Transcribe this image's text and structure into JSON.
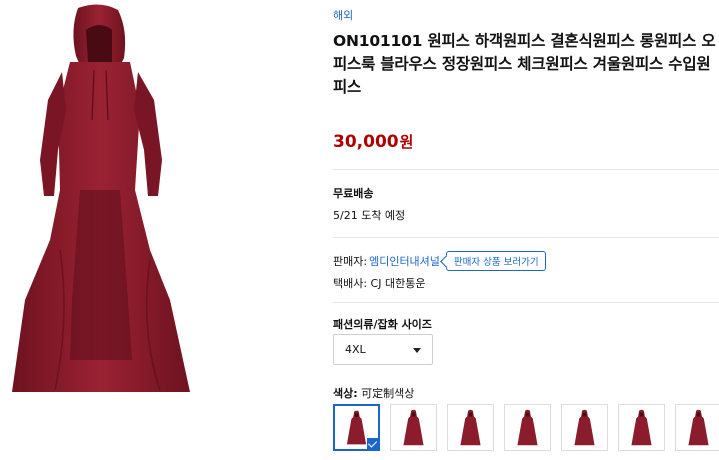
{
  "product": {
    "origin_tag": "해외",
    "title": "ON101101 원피스 하객원피스 결혼식원피스 롱원피스 오피스룩 블라우스 정장원피스 체크원피스 겨울원피스 수입원피스",
    "price": "30,000",
    "currency": "원",
    "image_icon": "hooded-dress-image"
  },
  "shipping": {
    "title": "무료배송",
    "eta": "5/21 도착 예정"
  },
  "seller": {
    "label": "판매자:",
    "name": "엠디인터내셔널",
    "button": "판매자 상품 보러가기",
    "courier": "택배사: CJ 대한통운"
  },
  "option": {
    "size_label": "패션의류/잡화 사이즈",
    "size_value": "4XL",
    "color_label_bold": "색상:",
    "color_value": "可定制색상",
    "swatch_count": 7
  },
  "colors": {
    "link": "#1a66cc",
    "price": "#ae0000",
    "dress": "#8a1c2c"
  }
}
